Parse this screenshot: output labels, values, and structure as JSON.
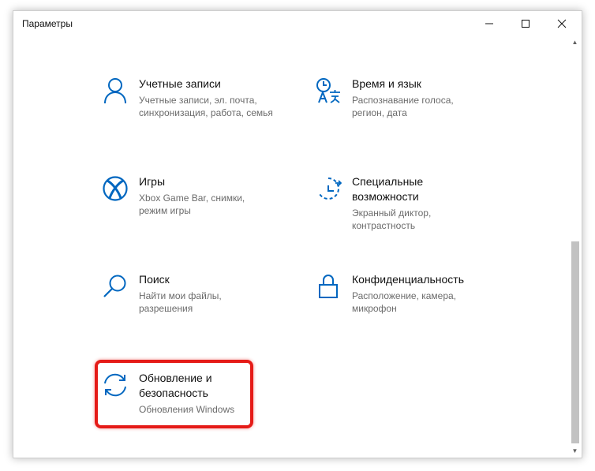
{
  "window": {
    "title": "Параметры"
  },
  "tiles": [
    {
      "title": "Учетные записи",
      "desc": "Учетные записи, эл. почта, синхронизация, работа, семья",
      "icon": "person-icon"
    },
    {
      "title": "Время и язык",
      "desc": "Распознавание голоса, регион, дата",
      "icon": "time-language-icon"
    },
    {
      "title": "Игры",
      "desc": "Xbox Game Bar, снимки, режим игры",
      "icon": "xbox-icon"
    },
    {
      "title": "Специальные возможности",
      "desc": "Экранный диктор, контрастность",
      "icon": "ease-of-access-icon"
    },
    {
      "title": "Поиск",
      "desc": "Найти мои файлы, разрешения",
      "icon": "search-icon"
    },
    {
      "title": "Конфиденциальность",
      "desc": "Расположение, камера, микрофон",
      "icon": "lock-icon"
    },
    {
      "title": "Обновление и безопасность",
      "desc": "Обновления Windows",
      "icon": "sync-icon"
    }
  ],
  "colors": {
    "accent": "#0067c0",
    "highlight": "#e51b17"
  }
}
